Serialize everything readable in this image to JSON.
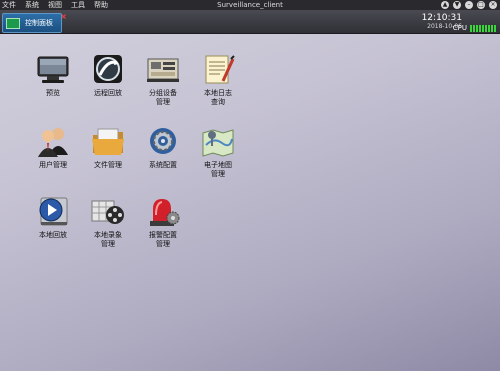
{
  "menubar": {
    "menus": [
      "文件",
      "系统",
      "视图",
      "工具",
      "帮助"
    ],
    "title": "Surveillance_client",
    "controls": [
      "▲",
      "▼",
      "–",
      "□",
      "×"
    ]
  },
  "tab": {
    "label": "控制面板",
    "close": "×"
  },
  "status": {
    "time": "12:10:31",
    "date": "2018-10-06",
    "cpu_label": "CPU",
    "cpu_bars_lit": 9,
    "cpu_bars_total": 9
  },
  "icons": [
    {
      "label": "预览",
      "icon": "monitor-icon"
    },
    {
      "label": "远程回放",
      "icon": "remote-playback-icon"
    },
    {
      "label": "分组设备\n管理",
      "icon": "device-group-icon"
    },
    {
      "label": "本地日志\n查询",
      "icon": "local-log-icon"
    },
    {
      "label": "用户管理",
      "icon": "users-icon"
    },
    {
      "label": "文件管理",
      "icon": "folder-icon"
    },
    {
      "label": "系统配置",
      "icon": "system-config-icon"
    },
    {
      "label": "电子地图\n管理",
      "icon": "map-icon"
    },
    {
      "label": "本地回放",
      "icon": "local-playback-icon"
    },
    {
      "label": "本地录象\n管理",
      "icon": "local-record-icon"
    },
    {
      "label": "报警配置\n管理",
      "icon": "alarm-config-icon"
    }
  ]
}
